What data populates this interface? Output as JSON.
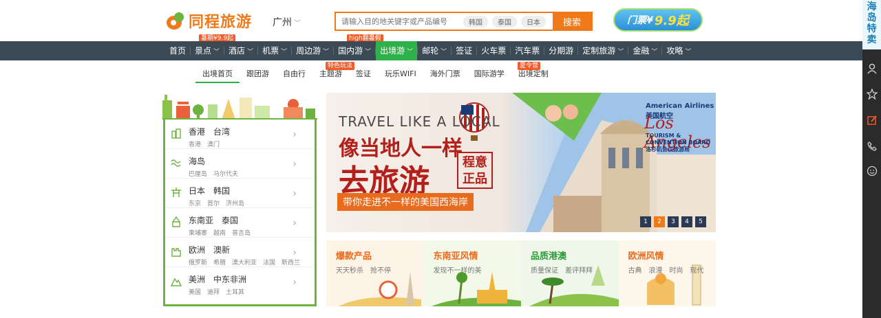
{
  "header": {
    "logo_text": "同程旅游",
    "city": "广州",
    "search": {
      "placeholder": "请输入目的地关键字或产品编号",
      "tags": [
        "韩国",
        "泰国",
        "日本"
      ],
      "button": "搜索"
    },
    "promo": {
      "text": "门票¥",
      "price": "9.9起"
    }
  },
  "badges": {
    "jingdian": "暑期¥9.9起",
    "guoneiyou": "high翻暑假",
    "zhutiyou": "特色玩法",
    "guojiyouxue": "夏令营"
  },
  "nav": {
    "items": [
      {
        "label": "首页",
        "chevron": false
      },
      {
        "label": "景点",
        "chevron": true
      },
      {
        "label": "酒店",
        "chevron": true
      },
      {
        "label": "机票",
        "chevron": true
      },
      {
        "label": "周边游",
        "chevron": true
      },
      {
        "label": "国内游",
        "chevron": true
      },
      {
        "label": "出境游",
        "chevron": true,
        "active": true
      },
      {
        "label": "邮轮",
        "chevron": true
      },
      {
        "label": "签证",
        "chevron": false
      },
      {
        "label": "火车票",
        "chevron": false
      },
      {
        "label": "汽车票",
        "chevron": false
      },
      {
        "label": "分期游",
        "chevron": false
      },
      {
        "label": "定制旅游",
        "chevron": true
      },
      {
        "label": "金融",
        "chevron": true
      },
      {
        "label": "攻略",
        "chevron": true
      }
    ]
  },
  "subnav": {
    "items": [
      "出境首页",
      "跟团游",
      "自由行",
      "主题游",
      "签证",
      "玩乐WIFI",
      "海外门票",
      "国际游学",
      "出境定制"
    ],
    "active_index": 0
  },
  "regions": [
    {
      "title": "香港　台湾",
      "sub": "香港　澳门",
      "icon": "building-icon"
    },
    {
      "title": "海岛",
      "sub": "巴厘岛　马尔代夫",
      "icon": "wave-icon"
    },
    {
      "title": "日本　韩国",
      "sub": "东京　首尔　济州岛",
      "icon": "pagoda-icon"
    },
    {
      "title": "东南亚　泰国",
      "sub": "柬埔寨　越南　普吉岛",
      "icon": "temple-icon"
    },
    {
      "title": "欧洲　澳新",
      "sub": "俄罗斯　希腊　澳大利亚　法国　新西兰",
      "icon": "castle-icon"
    },
    {
      "title": "美洲　中东非洲",
      "sub": "美国　迪拜　土耳其",
      "icon": "mountain-icon"
    }
  ],
  "banner": {
    "tagline": "TRAVEL LIKE A LOCAL",
    "headline1": "像当地人一样",
    "headline2": "去旅游",
    "stamp_line1": "程意",
    "stamp_line2": "正品",
    "ribbon": "带你走进不一样的美国西海岸",
    "airline": "American Airlines 美国航空",
    "city_script": "Los Angeles",
    "tourism_board": "TOURISM & CONVENTION BOARD",
    "tourism_board_cn": "洛杉矶会议旅游局",
    "pages": [
      "1",
      "2",
      "3",
      "4",
      "5"
    ],
    "active_page": 1
  },
  "cards": [
    {
      "title": "爆款产品",
      "subtitle": "天天秒杀　抢不停",
      "color": "#e96b1e",
      "bg": "#fdf3e6"
    },
    {
      "title": "东南亚风情",
      "subtitle": "发现不一样的美",
      "color": "#e96b1e",
      "bg": "#f3f8e8"
    },
    {
      "title": "品质港澳",
      "subtitle": "质量保证　差评拜拜",
      "color": "#2e9a3a",
      "bg": "#eef7ea"
    },
    {
      "title": "欧洲风情",
      "subtitle": "古典　浪漫　时尚　现代",
      "color": "#e96b1e",
      "bg": "#fdf6ea"
    }
  ],
  "sidebar": {
    "top_text": "海岛特卖",
    "icons": [
      "user-icon",
      "star-icon",
      "edit-icon",
      "phone-icon",
      "smile-icon"
    ]
  },
  "colors": {
    "brand_orange": "#f07a1a",
    "brand_green": "#2eb14a",
    "nav_bg": "#3b4a55"
  }
}
